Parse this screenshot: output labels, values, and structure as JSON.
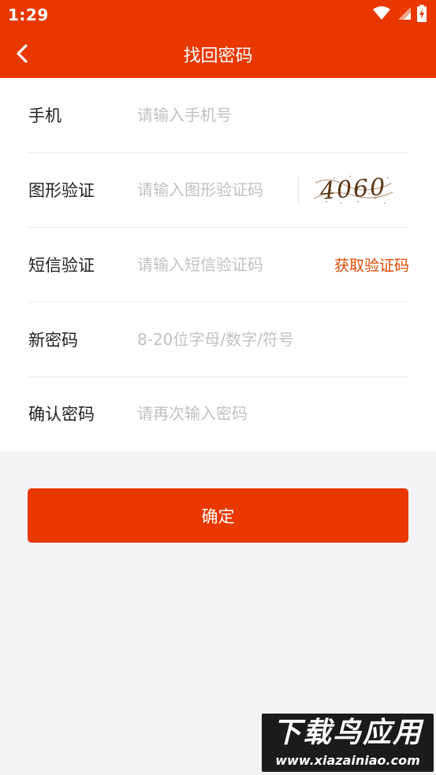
{
  "status_bar": {
    "time": "1:29",
    "icons": [
      "wifi-icon",
      "cellular-signal-icon",
      "battery-charging-icon"
    ]
  },
  "header": {
    "title": "找回密码",
    "back_icon": "chevron-left-icon"
  },
  "form": {
    "phone": {
      "label": "手机",
      "placeholder": "请输入手机号",
      "value": ""
    },
    "graphic_code": {
      "label": "图形验证",
      "placeholder": "请输入图形验证码",
      "value": "",
      "captcha_text": "4060"
    },
    "sms_code": {
      "label": "短信验证",
      "placeholder": "请输入短信验证码",
      "value": "",
      "get_code_label": "获取验证码"
    },
    "new_password": {
      "label": "新密码",
      "placeholder": "8-20位字母/数字/符号",
      "value": ""
    },
    "confirm_password": {
      "label": "确认密码",
      "placeholder": "请再次输入密码",
      "value": ""
    }
  },
  "confirm_button": {
    "label": "确定"
  },
  "watermark": {
    "cn": "下载鸟应用",
    "en": "www.xiazainiao.com"
  },
  "colors": {
    "brand": "#e83800",
    "link": "#e04a00",
    "placeholder": "#c2c2c2",
    "background": "#f4f4f6"
  }
}
